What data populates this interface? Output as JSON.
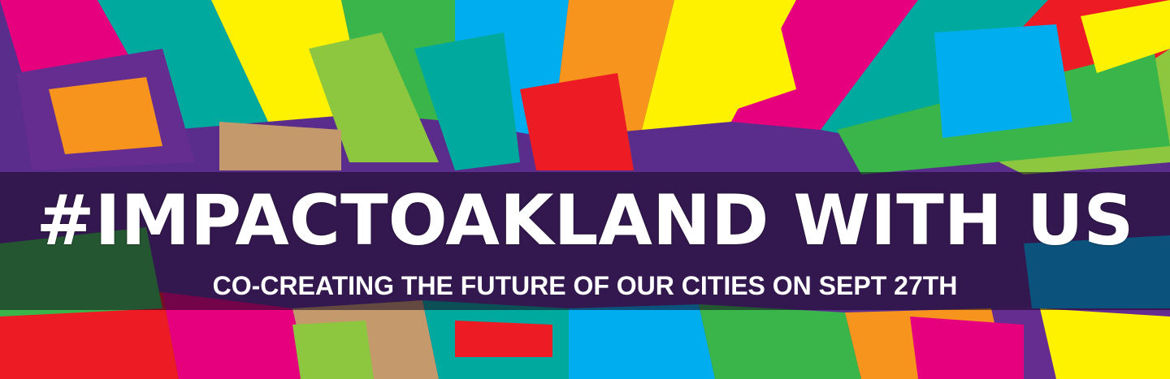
{
  "banner": {
    "headline": "#IMPACTOAKLAND WITH US",
    "subline": "CO-CREATING THE FUTURE OF OUR CITIES ON SEPT 27TH"
  },
  "colors": {
    "palette": [
      "#e6007e",
      "#00a99d",
      "#fff200",
      "#f7941d",
      "#39b54a",
      "#662d91",
      "#00aeef",
      "#ed1c24",
      "#c49a6c",
      "#8dc63f"
    ],
    "overlay": "#14081e",
    "text": "#ffffff"
  }
}
